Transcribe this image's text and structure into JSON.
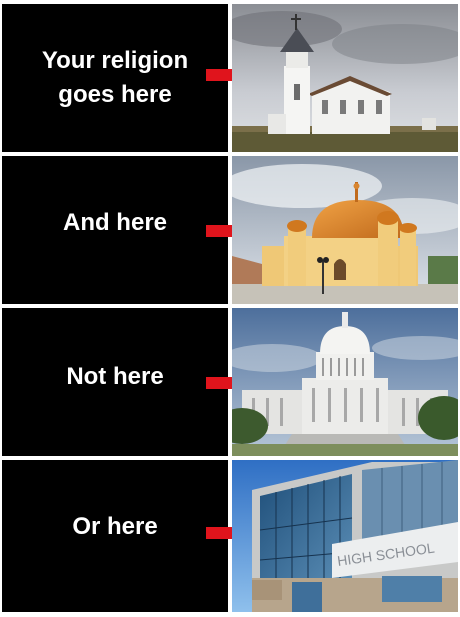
{
  "rows": [
    {
      "label_line1": "Your religion",
      "label_line2": "goes here",
      "image": "church-photo"
    },
    {
      "label": "And here",
      "image": "mosque-photo"
    },
    {
      "label": "Not here",
      "image": "capitol-photo"
    },
    {
      "label": "Or here",
      "image": "high-school-photo"
    }
  ],
  "school_sign": "HIGH SCHOOL",
  "colors": {
    "panel": "#000000",
    "text": "#ffffff",
    "arrow": "#e0141c"
  }
}
